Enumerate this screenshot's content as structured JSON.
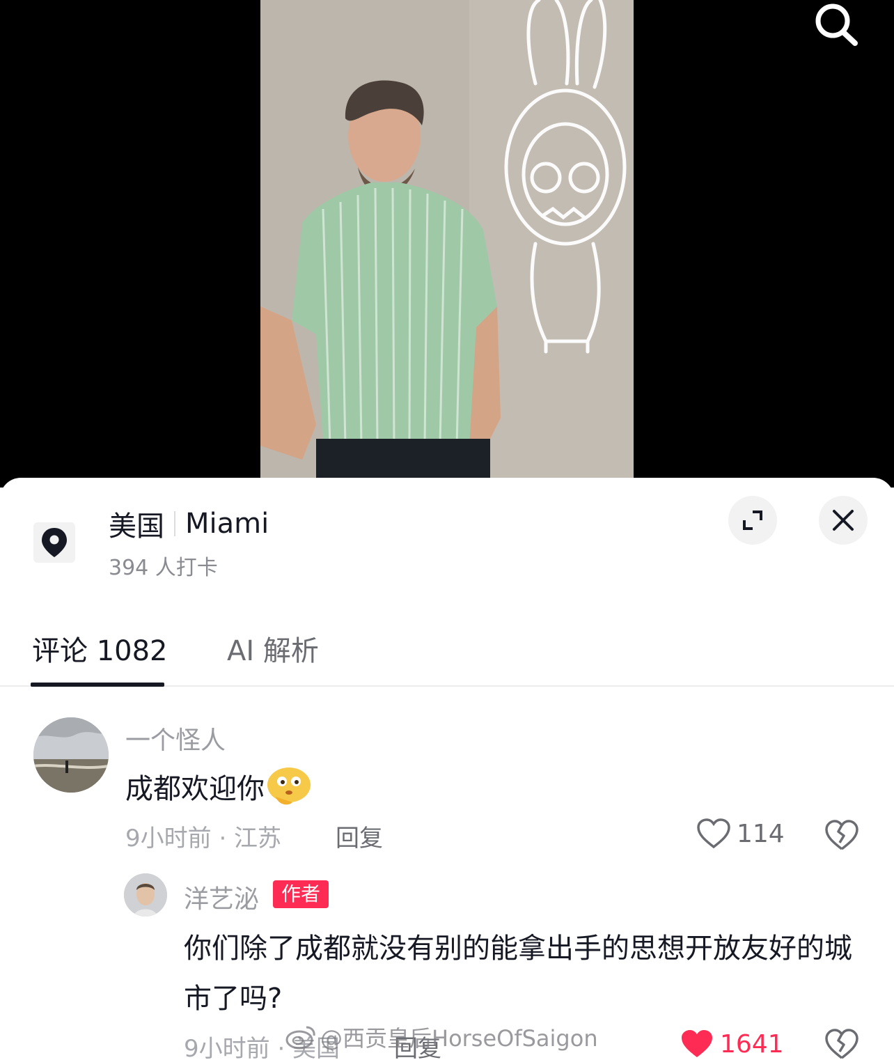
{
  "video": {
    "search_icon": "search-icon"
  },
  "location": {
    "icon": "location-pin-icon",
    "country": "美国",
    "city": "Miami",
    "checkins": "394 人打卡",
    "expand_icon": "expand-icon",
    "close_icon": "close-icon"
  },
  "tabs": [
    {
      "label": "评论 1082",
      "active": true
    },
    {
      "label": "AI 解析",
      "active": false
    }
  ],
  "comments": [
    {
      "username": "一个怪人",
      "text": "成都欢迎你",
      "emoji": "thinking-face-emoji",
      "meta": "9小时前 · 江苏",
      "reply_label": "回复",
      "likes": "114",
      "liked": false
    },
    {
      "username": "洋艺泌",
      "badge": "作者",
      "text": "你们除了成都就没有别的能拿出手的思想开放友好的城市了吗?",
      "meta": "9小时前 · 美国",
      "reply_label": "回复",
      "likes": "1641",
      "liked": true
    }
  ],
  "watermark": "@西贡皇后HorseOfSaigon",
  "colors": {
    "accent": "#fe2c55",
    "text_primary": "#161823",
    "text_secondary": "#8a8b91"
  }
}
